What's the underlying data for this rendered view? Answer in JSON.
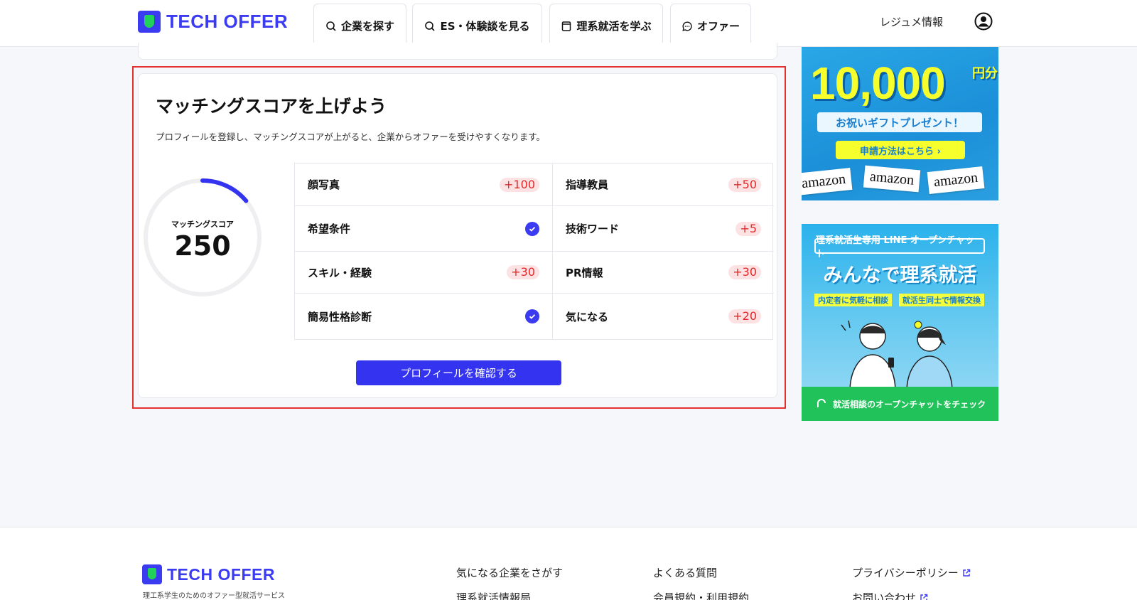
{
  "header": {
    "logo_text": "TECH OFFER",
    "nav": [
      {
        "label": "企業を探す",
        "icon": "search-icon"
      },
      {
        "label": "ES・体験談を見る",
        "icon": "search-icon"
      },
      {
        "label": "理系就活を学ぶ",
        "icon": "book-icon"
      },
      {
        "label": "オファー",
        "icon": "chat-icon"
      }
    ],
    "resume_link": "レジュメ情報",
    "avatar_icon": "user-icon"
  },
  "matching": {
    "title": "マッチングスコアを上げよう",
    "description": "プロフィールを登録し、マッチングスコアが上がると、企業からオファーを受けやすくなります。",
    "score_label": "マッチングスコア",
    "score_value": "250",
    "items": [
      {
        "label": "顔写真",
        "badge": "+100"
      },
      {
        "label": "指導教員",
        "badge": "+50"
      },
      {
        "label": "希望条件",
        "status": "completed"
      },
      {
        "label": "技術ワード",
        "badge": "+5"
      },
      {
        "label": "スキル・経験",
        "badge": "+30"
      },
      {
        "label": "PR情報",
        "badge": "+30"
      },
      {
        "label": "簡易性格診断",
        "status": "completed"
      },
      {
        "label": "気になる",
        "badge": "+20"
      }
    ],
    "confirm_button": "プロフィールを確認する"
  },
  "banners": {
    "gift": {
      "amount": "10,000",
      "unit": "円分",
      "ribbon": "お祝いギフトプレゼント！",
      "button": "申請方法はこちら ›",
      "brand": "amazon"
    },
    "line": {
      "top": "理系就活生専用 LINE オープンチャット",
      "title": "みんなで理系就活",
      "tag1": "内定者に気軽に相談",
      "tag2": "就活生同士で情報交換",
      "bottom": "就活相談のオープンチャットをチェック"
    }
  },
  "footer": {
    "logo_text": "TECH OFFER",
    "tagline": "理工系学生のためのオファー型就活サービス",
    "col1": [
      "気になる企業をさがす",
      "理系就活情報局"
    ],
    "col2": [
      "よくある質問",
      "会員規約・利用規約"
    ],
    "col3": [
      "プライバシーポリシー",
      "お問い合わせ"
    ]
  },
  "colors": {
    "brand": "#3b3bf2",
    "accent_green": "#22d15a",
    "badge_bg": "#fde2e4",
    "badge_text": "#e02a2a",
    "highlight_border": "#e53030"
  }
}
